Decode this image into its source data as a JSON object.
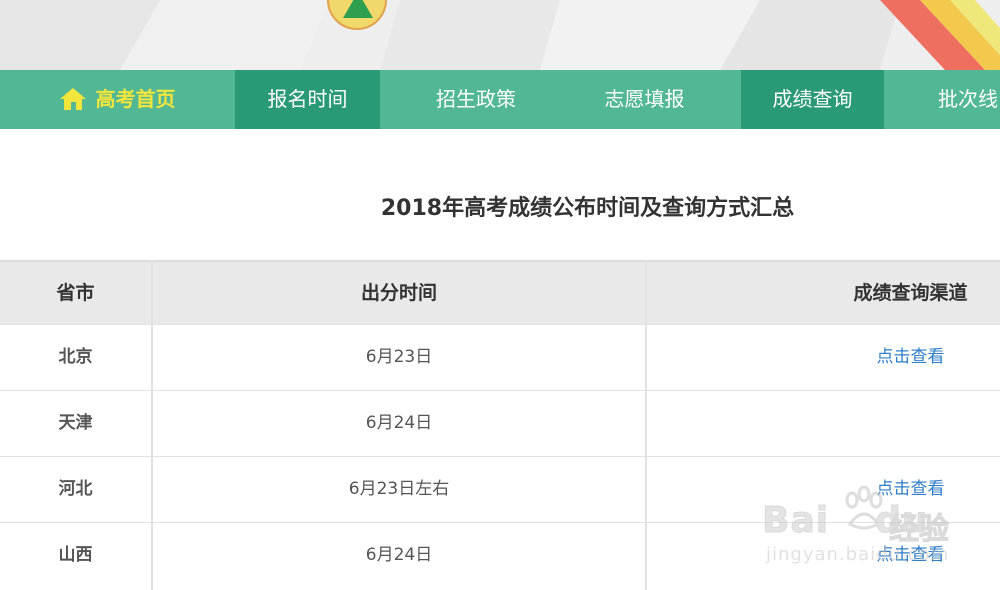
{
  "nav": {
    "items": [
      {
        "label": "高考首页",
        "active": false
      },
      {
        "label": "报名时间",
        "active": true
      },
      {
        "label": "招生政策",
        "active": false
      },
      {
        "label": "志愿填报",
        "active": false
      },
      {
        "label": "成绩查询",
        "active": true
      },
      {
        "label": "批次线",
        "active": false
      }
    ]
  },
  "page": {
    "title": "2018年高考成绩公布时间及查询方式汇总"
  },
  "table": {
    "headers": [
      "省市",
      "出分时间",
      "成绩查询渠道"
    ],
    "rows": [
      {
        "province": "北京",
        "time": "6月23日",
        "channel": "点击查看"
      },
      {
        "province": "天津",
        "time": "6月24日",
        "channel": ""
      },
      {
        "province": "河北",
        "time": "6月23日左右",
        "channel": "点击查看"
      },
      {
        "province": "山西",
        "time": "6月24日",
        "channel": "点击查看"
      }
    ]
  },
  "watermark": {
    "brand": "Bai",
    "brand_tail": "du",
    "brand_cn": "经验",
    "url": "jingyan.baidu.com"
  },
  "colors": {
    "nav_bg": "#52b795",
    "nav_active": "#2a9a76",
    "nav_home_text": "#f2e53b",
    "link": "#2f7ec7",
    "header_bg": "#e9e9e9"
  }
}
